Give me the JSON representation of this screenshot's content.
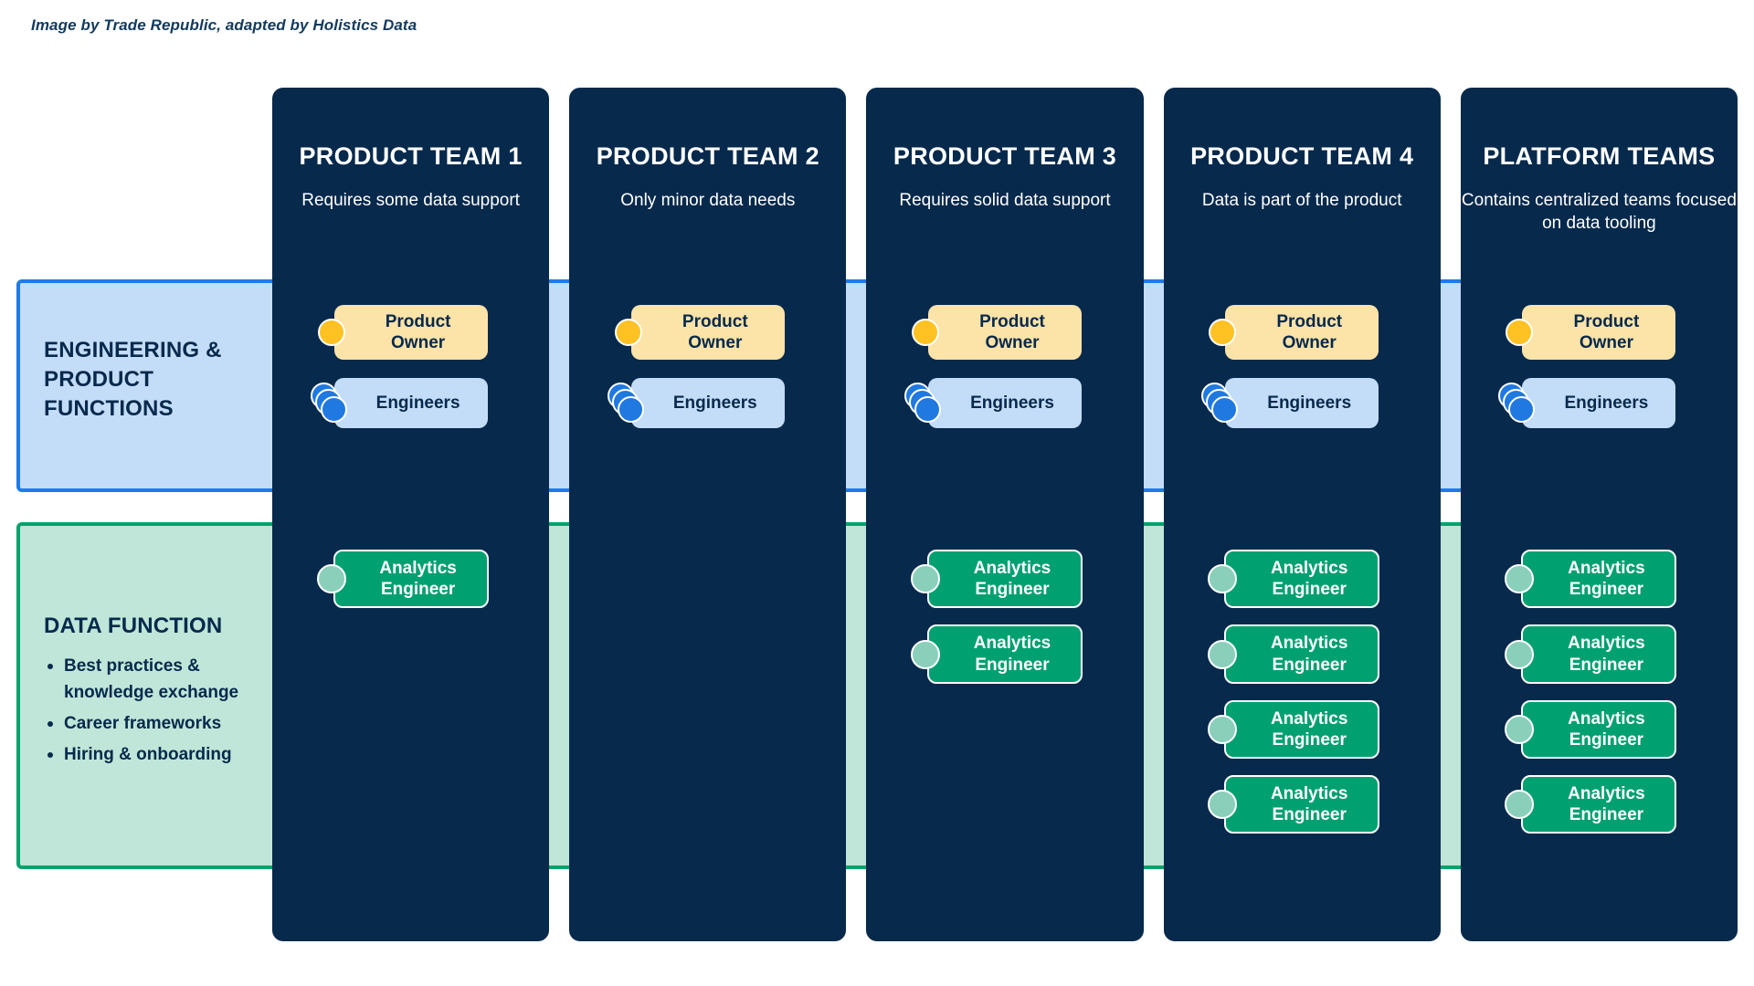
{
  "caption": "Image by Trade Republic, adapted by Holistics Data",
  "colors": {
    "column_navy": "#06294C",
    "engineering_band_fill": "#C3DCF8",
    "engineering_band_border": "#1E7BE8",
    "data_band_fill": "#BFE6D8",
    "data_band_border": "#00A36C",
    "product_owner_chip": "#FCE3A8",
    "product_owner_dot": "#FFC222",
    "engineers_chip": "#C3DCF8",
    "engineers_dot": "#2079E0",
    "analytics_engineer_chip": "#00A070",
    "analytics_engineer_dot": "#8ACFBA"
  },
  "bands": {
    "engineering": {
      "label": "ENGINEERING & PRODUCT FUNCTIONS"
    },
    "data": {
      "title": "DATA FUNCTION",
      "bullets": [
        "Best practices & knowledge exchange",
        "Career frameworks",
        "Hiring & onboarding"
      ]
    }
  },
  "chip_labels": {
    "product_owner": "Product Owner",
    "engineers": "Engineers",
    "analytics_engineer": "Analytics Engineer"
  },
  "columns": [
    {
      "title": "PRODUCT TEAM 1",
      "subtitle": "Requires some data support",
      "product_owners": 1,
      "engineers": 1,
      "analytics_engineers": 1
    },
    {
      "title": "PRODUCT TEAM 2",
      "subtitle": "Only minor data needs",
      "product_owners": 1,
      "engineers": 1,
      "analytics_engineers": 0
    },
    {
      "title": "PRODUCT TEAM 3",
      "subtitle": "Requires solid data support",
      "product_owners": 1,
      "engineers": 1,
      "analytics_engineers": 2
    },
    {
      "title": "PRODUCT TEAM 4",
      "subtitle": "Data is part of the product",
      "product_owners": 1,
      "engineers": 1,
      "analytics_engineers": 4
    },
    {
      "title": "PLATFORM TEAMS",
      "subtitle": "Contains centralized teams focused on data tooling",
      "product_owners": 1,
      "engineers": 1,
      "analytics_engineers": 4
    }
  ]
}
